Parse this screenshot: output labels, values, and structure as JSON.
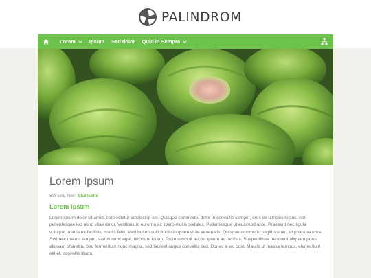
{
  "brand": {
    "name": "PALINDROM"
  },
  "nav": {
    "items": [
      {
        "label": "Lorem",
        "has_dropdown": true
      },
      {
        "label": "Ipsum",
        "has_dropdown": false
      },
      {
        "label": "Sed dolor",
        "has_dropdown": false
      },
      {
        "label": "Quid in Sempra",
        "has_dropdown": true
      }
    ],
    "home_icon": "home-icon",
    "right_icon": "sitemap-icon"
  },
  "hero": {
    "image": "brussels-sprouts-photo"
  },
  "main": {
    "title": "Lorem Ipsum",
    "breadcrumb_prefix": "Sie sind hier:",
    "breadcrumb_link": "Startseite",
    "heading": "Lorem Ipsum",
    "paragraph": "Lorem ipsum dolor sit amet, consectetur adipiscing elit. Quisque commodo, dolor in convallis semper, eros ex ultricies lectus, non pellentesque leo nunc vitae dolor. Vestibulum eu urna ac libero mollis sodales. Pellentesque ut euismod ante. Praesent nec ligula volutpat, mattis mi facilisis, mattis felis. Vestibulum sollicitudin in quam vitae venenatis. Quisque commodo sagittis enim, id pharetra urna. Sed nec mauris tempor, varius nunc eget, tincidunt lorem. Proin suscipit auctor ipsum ac facilisis. Suspendisse hendrerit aliquam purus aliquam pharetra. Sed fermentum nunc magna, sed laoreet augue convallis sed. Donec a leo odio. Mauris ut massa tempus, elementum elit et, convallis libero."
  },
  "colors": {
    "accent": "#6cc24a",
    "page_background": "#f3f1ec",
    "text": "#707070",
    "title": "#666666"
  }
}
